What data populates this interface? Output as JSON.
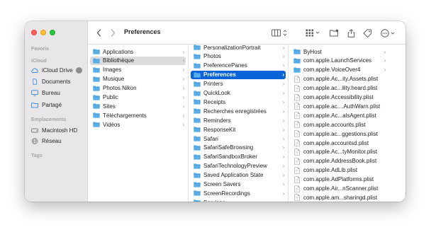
{
  "window": {
    "title": "Preferences"
  },
  "sidebar": {
    "sections": [
      {
        "heading": "Favoris",
        "items": []
      },
      {
        "heading": "iCloud",
        "items": [
          {
            "label": "iCloud Drive",
            "icon": "cloud-icon"
          },
          {
            "label": "Documents",
            "icon": "document-icon"
          },
          {
            "label": "Bureau",
            "icon": "desktop-icon"
          },
          {
            "label": "Partagé",
            "icon": "shared-folder-icon"
          }
        ]
      },
      {
        "heading": "Emplacements",
        "items": [
          {
            "label": "Macintosh HD",
            "icon": "disk-icon"
          },
          {
            "label": "Réseau",
            "icon": "network-icon"
          }
        ]
      },
      {
        "heading": "Tags",
        "items": []
      }
    ]
  },
  "columns": [
    {
      "items": [
        {
          "label": "Applications",
          "type": "folder",
          "chevron": true
        },
        {
          "label": "Bibliothèque",
          "type": "folder",
          "chevron": true,
          "selected": "gray"
        },
        {
          "label": "Images",
          "type": "folder",
          "chevron": true
        },
        {
          "label": "Musique",
          "type": "folder",
          "chevron": true
        },
        {
          "label": "Photos Nikon",
          "type": "folder",
          "chevron": true
        },
        {
          "label": "Public",
          "type": "folder",
          "chevron": true
        },
        {
          "label": "Sites",
          "type": "folder",
          "chevron": true
        },
        {
          "label": "Téléchargements",
          "type": "folder",
          "chevron": true
        },
        {
          "label": "Vidéos",
          "type": "folder",
          "chevron": true
        }
      ]
    },
    {
      "items": [
        {
          "label": "PersonalizationPortrait",
          "type": "folder",
          "chevron": true
        },
        {
          "label": "Photos",
          "type": "folder",
          "chevron": true
        },
        {
          "label": "PreferencePanes",
          "type": "folder",
          "chevron": true
        },
        {
          "label": "Preferences",
          "type": "folder",
          "chevron": true,
          "selected": "blue"
        },
        {
          "label": "Printers",
          "type": "folder",
          "chevron": true
        },
        {
          "label": "QuickLook",
          "type": "folder",
          "chevron": true
        },
        {
          "label": "Receipts",
          "type": "folder",
          "chevron": true
        },
        {
          "label": "Recherches enregistrées",
          "type": "folder",
          "chevron": true
        },
        {
          "label": "Reminders",
          "type": "folder",
          "chevron": true
        },
        {
          "label": "ResponseKit",
          "type": "folder",
          "chevron": true
        },
        {
          "label": "Safari",
          "type": "folder",
          "chevron": true
        },
        {
          "label": "SafariSafeBrowsing",
          "type": "folder",
          "chevron": true
        },
        {
          "label": "SafariSandboxBroker",
          "type": "folder",
          "chevron": true
        },
        {
          "label": "SafariTechnologyPreview",
          "type": "folder",
          "chevron": true
        },
        {
          "label": "Saved Application State",
          "type": "folder",
          "chevron": true
        },
        {
          "label": "Screen Savers",
          "type": "folder",
          "chevron": true
        },
        {
          "label": "ScreenRecordings",
          "type": "folder",
          "chevron": true
        },
        {
          "label": "Services",
          "type": "folder",
          "chevron": true
        }
      ]
    },
    {
      "items": [
        {
          "label": "ByHost",
          "type": "folder",
          "chevron": true
        },
        {
          "label": "com.apple.LaunchServices",
          "type": "folder",
          "chevron": true
        },
        {
          "label": "com.apple.VoiceOver4",
          "type": "folder",
          "chevron": true
        },
        {
          "label": "com.apple.Ac...ity.Assets.plist",
          "type": "file",
          "chevron": false
        },
        {
          "label": "com.apple.ac...ility.heard.plist",
          "type": "file",
          "chevron": false
        },
        {
          "label": "com.apple.Accessibility.plist",
          "type": "file",
          "chevron": false
        },
        {
          "label": "com.apple.ac....AuthWarn.plist",
          "type": "file",
          "chevron": false
        },
        {
          "label": "com.apple.Ac...alsAgent.plist",
          "type": "file",
          "chevron": false
        },
        {
          "label": "com.apple.accounts.plist",
          "type": "file",
          "chevron": false
        },
        {
          "label": "com.apple.ac...ggestions.plist",
          "type": "file",
          "chevron": false
        },
        {
          "label": "com.apple.accountsd.plist",
          "type": "file",
          "chevron": false
        },
        {
          "label": "com.apple.Ac...tyMonitor.plist",
          "type": "file",
          "chevron": false
        },
        {
          "label": "com.apple.AddressBook.plist",
          "type": "file",
          "chevron": false
        },
        {
          "label": "com.apple.AdLib.plist",
          "type": "file",
          "chevron": false
        },
        {
          "label": "com.apple.AdPlatforms.plist",
          "type": "file",
          "chevron": false
        },
        {
          "label": "com.apple.Air...nScanner.plist",
          "type": "file",
          "chevron": false
        },
        {
          "label": "com.apple.am...sharingd.plist",
          "type": "file",
          "chevron": false
        }
      ]
    }
  ],
  "colors": {
    "selection_blue": "#0a64d8",
    "folder_blue": "#5aaee8",
    "sidebar_bg": "#e8e6e8"
  }
}
